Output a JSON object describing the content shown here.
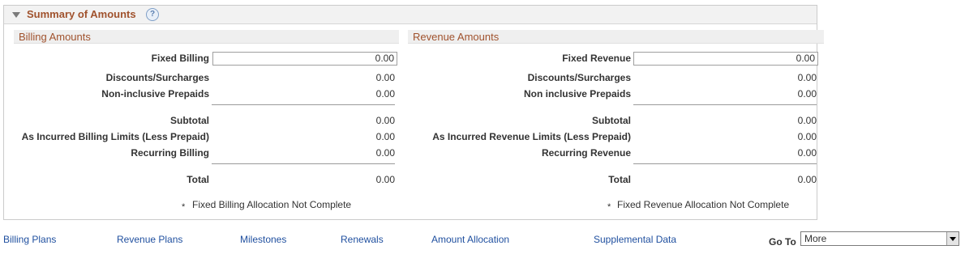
{
  "panel": {
    "title": "Summary of Amounts",
    "help_icon": "?"
  },
  "billing": {
    "heading": "Billing Amounts",
    "fixed_label": "Fixed Billing",
    "fixed_value": "0.00",
    "discounts_label": "Discounts/Surcharges",
    "discounts_value": "0.00",
    "prepaids_label": "Non-inclusive Prepaids",
    "prepaids_value": "0.00",
    "subtotal_label": "Subtotal",
    "subtotal_value": "0.00",
    "limits_label": "As Incurred Billing Limits (Less Prepaid)",
    "limits_value": "0.00",
    "recurring_label": "Recurring Billing",
    "recurring_value": "0.00",
    "total_label": "Total",
    "total_value": "0.00",
    "note_marker": "*",
    "note": "Fixed Billing Allocation Not Complete"
  },
  "revenue": {
    "heading": "Revenue Amounts",
    "fixed_label": "Fixed Revenue",
    "fixed_value": "0.00",
    "discounts_label": "Discounts/Surcharges",
    "discounts_value": "0.00",
    "prepaids_label": "Non inclusive Prepaids",
    "prepaids_value": "0.00",
    "subtotal_label": "Subtotal",
    "subtotal_value": "0.00",
    "limits_label": "As Incurred Revenue Limits (Less Prepaid)",
    "limits_value": "0.00",
    "recurring_label": "Recurring Revenue",
    "recurring_value": "0.00",
    "total_label": "Total",
    "total_value": "0.00",
    "note_marker": "*",
    "note": "Fixed Revenue Allocation Not Complete"
  },
  "links": {
    "billing_plans": "Billing Plans",
    "revenue_plans": "Revenue Plans",
    "milestones": "Milestones",
    "renewals": "Renewals",
    "amount_allocation": "Amount Allocation",
    "supplemental_data": "Supplemental Data"
  },
  "goto": {
    "label": "Go To",
    "selected": "More"
  },
  "colors": {
    "section_title": "#a0522d",
    "link": "#1f4f9f"
  }
}
